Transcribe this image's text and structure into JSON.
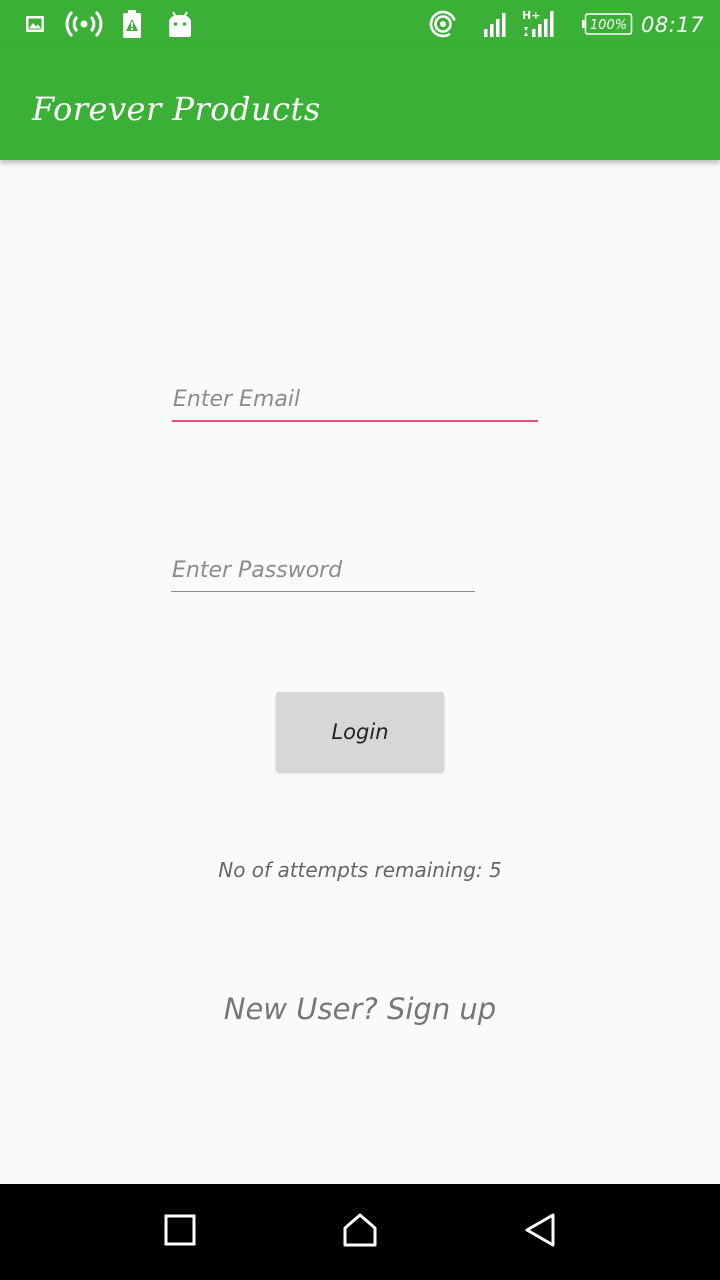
{
  "status_bar": {
    "time": "08:17",
    "battery_percent": "100%",
    "network_type": "H+",
    "icons": [
      "image-icon",
      "hotspot-icon",
      "battery-alert-icon",
      "android-icon",
      "wifi-hotspot-icon",
      "signal-icon",
      "network-signal-icon",
      "battery-icon"
    ]
  },
  "app_bar": {
    "title": "Forever Products"
  },
  "login_form": {
    "email": {
      "placeholder": "Enter Email",
      "value": ""
    },
    "password": {
      "placeholder": "Enter Password",
      "value": ""
    },
    "login_label": "Login",
    "attempts_text": "No of attempts remaining: 5",
    "signup_text": "New User? Sign up"
  },
  "nav_bar": {
    "icons": [
      "recents-icon",
      "home-icon",
      "back-icon"
    ]
  },
  "colors": {
    "primary": "#3bb036",
    "accent": "#e84c7d",
    "background": "#fafafa"
  }
}
